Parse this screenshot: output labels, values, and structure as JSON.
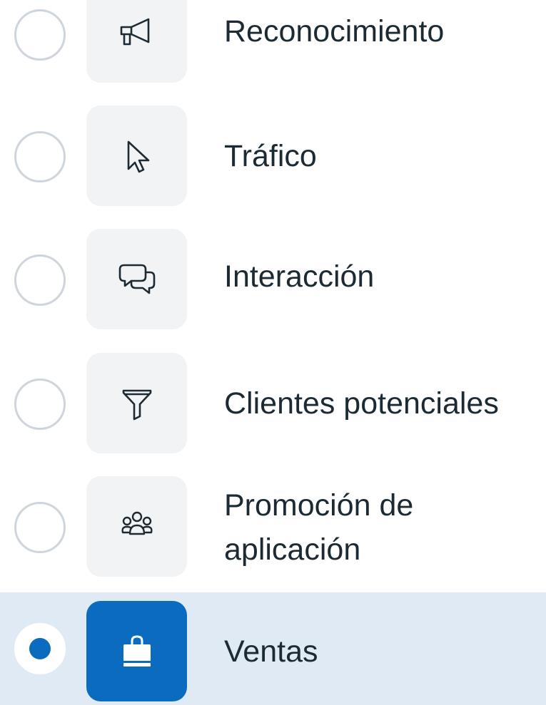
{
  "options": [
    {
      "label": "Reconocimiento",
      "icon": "megaphone-icon",
      "selected": false
    },
    {
      "label": "Tráfico",
      "icon": "cursor-icon",
      "selected": false
    },
    {
      "label": "Interacción",
      "icon": "chat-bubbles-icon",
      "selected": false
    },
    {
      "label": "Clientes potenciales",
      "icon": "funnel-icon",
      "selected": false
    },
    {
      "label": "Promoción de aplicación",
      "icon": "people-group-icon",
      "selected": false
    },
    {
      "label": "Ventas",
      "icon": "shopping-bag-icon",
      "selected": true
    }
  ],
  "colors": {
    "accent": "#0a6bbf",
    "selected_row_bg": "#e0eaf5",
    "tile_bg": "#f2f3f5",
    "text": "#1c2b33",
    "radio_border": "#cfd5dc"
  }
}
